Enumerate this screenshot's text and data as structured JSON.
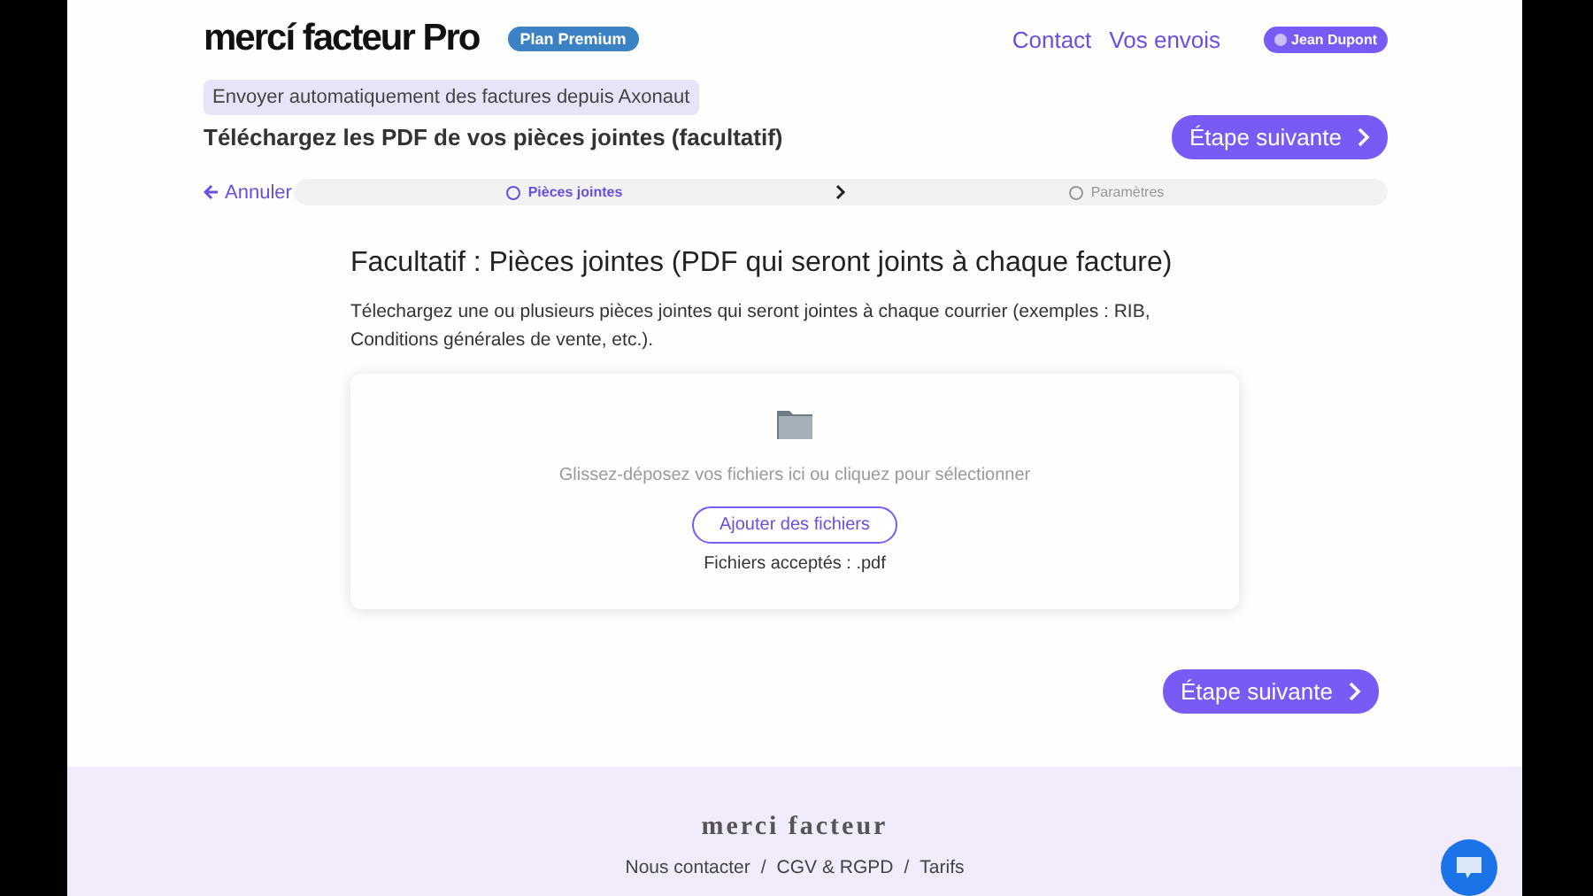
{
  "header": {
    "logo": "mercí facteur Pro",
    "plan_badge": "Plan Premium",
    "nav": [
      "Contact",
      "Vos envois"
    ],
    "user": "Jean Dupont"
  },
  "context_tag": "Envoyer automatiquement des factures depuis Axonaut",
  "page_title": "Téléchargez les PDF de vos pièces jointes (facultatif)",
  "next_button": "Étape suivante",
  "cancel_link": "Annuler",
  "steps": [
    {
      "label": "Pièces jointes",
      "selected": true
    },
    {
      "label": "Paramètres",
      "selected": false
    }
  ],
  "section": {
    "title": "Facultatif : Pièces jointes (PDF qui seront joints à chaque facture)",
    "description": "Télechargez une ou plusieurs pièces jointes qui seront jointes à chaque courrier (exemples : RIB, Conditions générales de vente, etc.)."
  },
  "dropzone": {
    "hint": "Glissez-déposez vos fichiers ici ou cliquez pour sélectionner",
    "button": "Ajouter des fichiers",
    "accepted": "Fichiers acceptés : .pdf"
  },
  "bottom_button": "Étape suivante",
  "footer": {
    "brand": "merci facteur",
    "links": [
      "Nous contacter",
      "CGV & RGPD",
      "Tarifs"
    ],
    "separator": "/"
  }
}
